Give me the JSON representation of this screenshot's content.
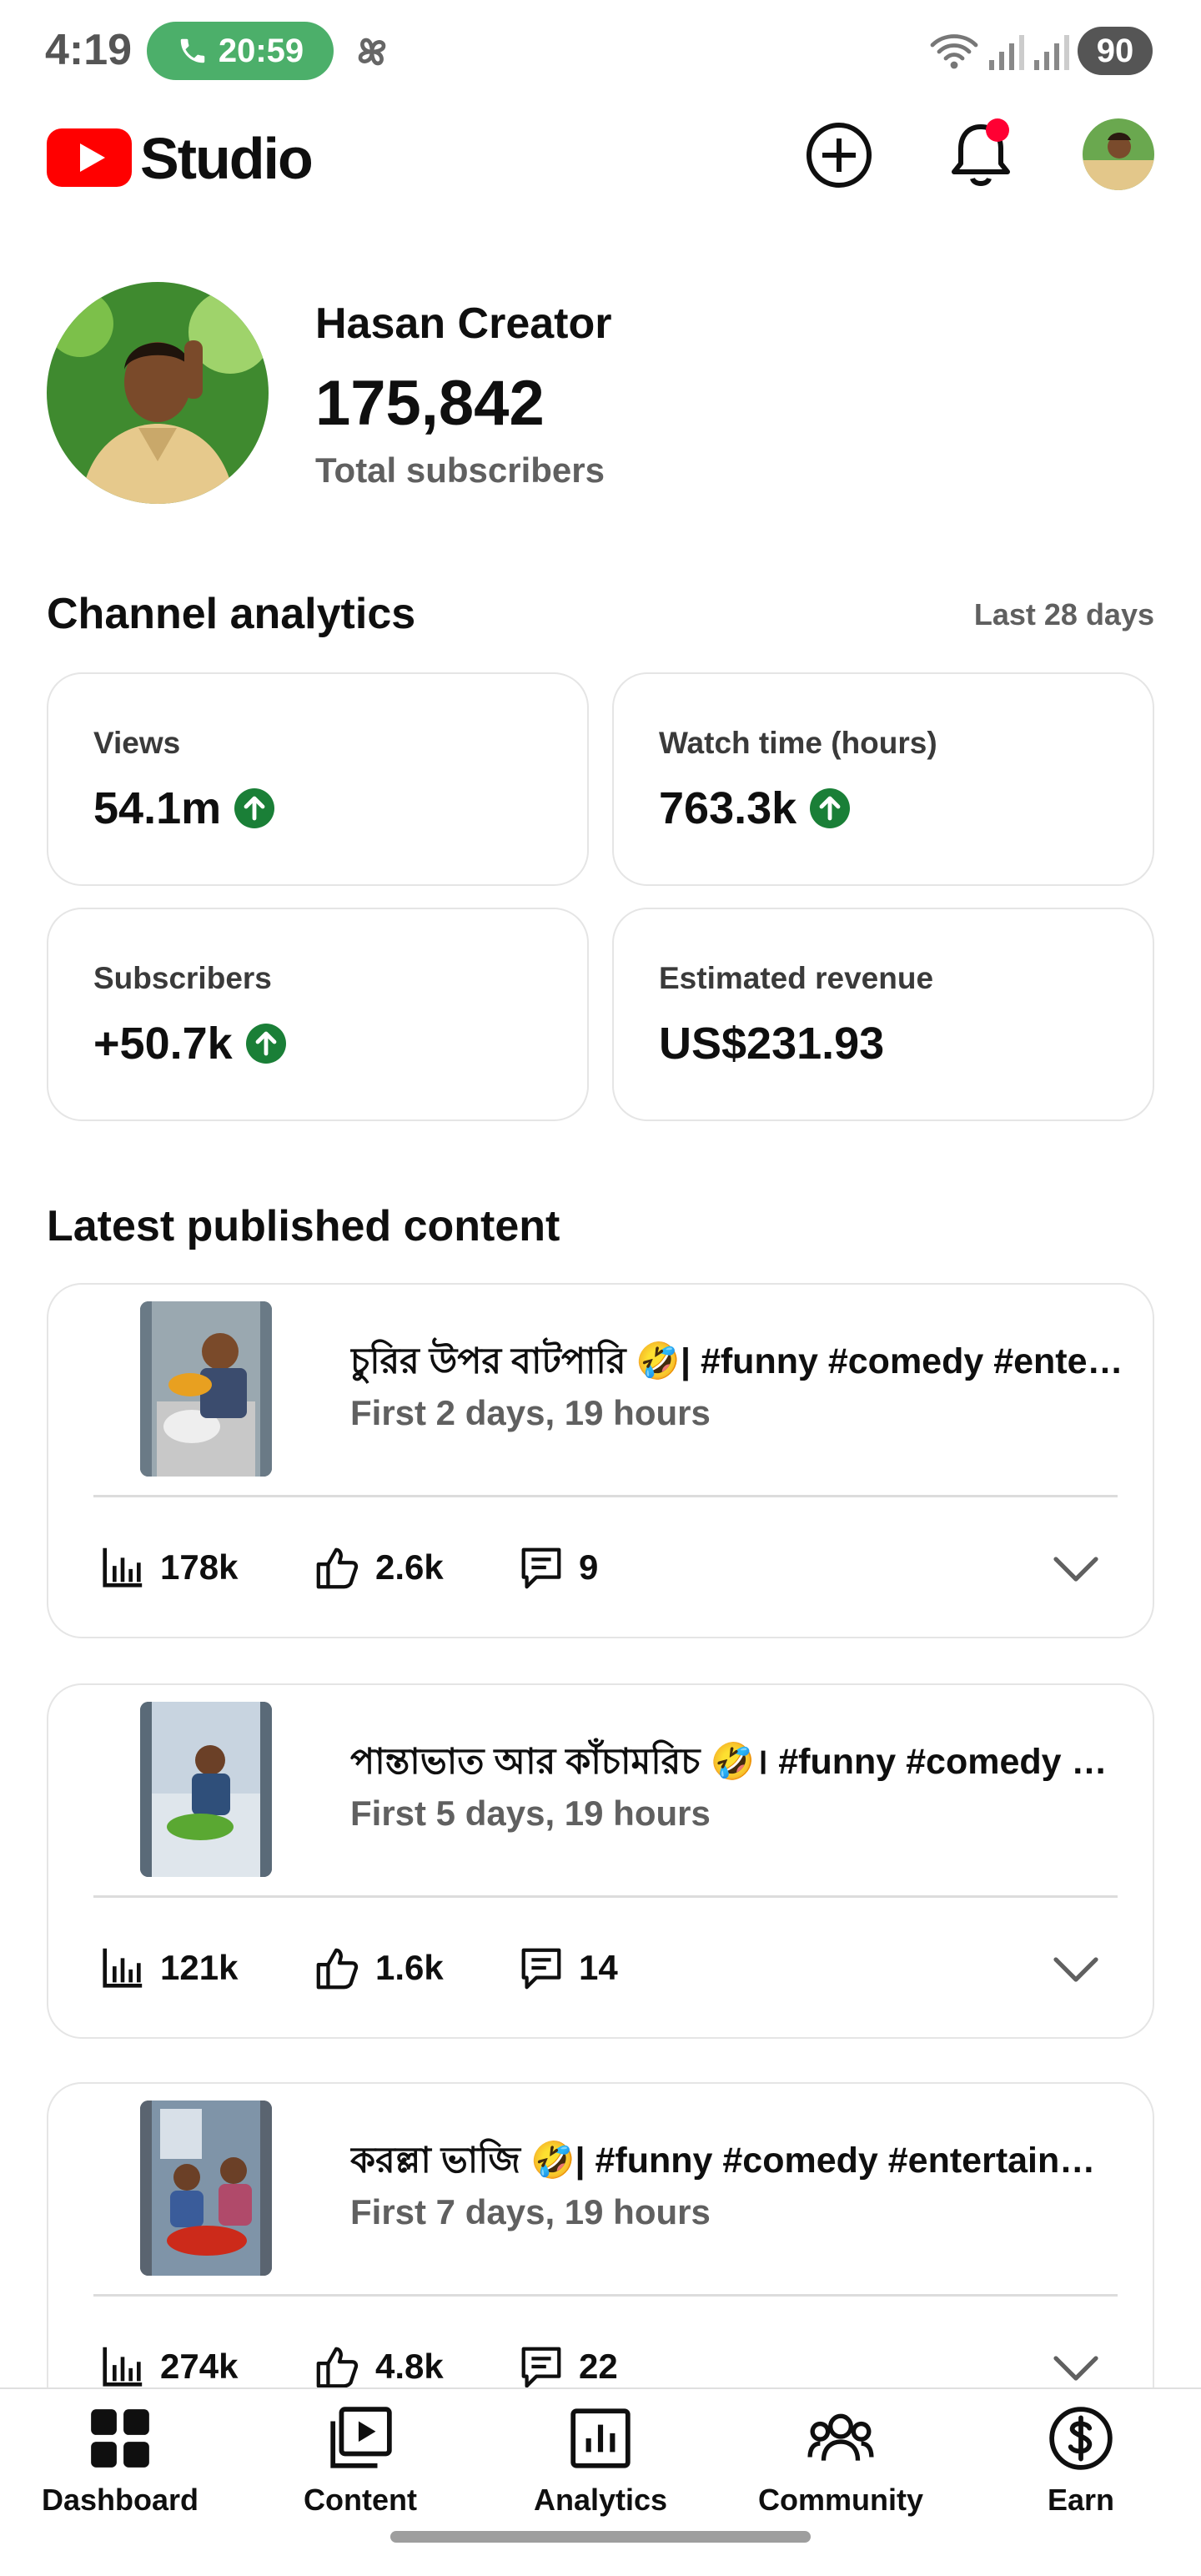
{
  "status_bar": {
    "time": "4:19",
    "call_duration": "20:59",
    "battery_level": "90",
    "icons": [
      "phone-icon",
      "pinwheel-icon",
      "wifi-icon",
      "signal-icon",
      "signal-icon"
    ]
  },
  "header": {
    "app_name": "Studio",
    "icons": [
      "youtube-logo",
      "create-icon",
      "notifications-icon",
      "account-avatar"
    ],
    "colors": {
      "brand": "#ff0000",
      "notification_dot": "#ff0033"
    }
  },
  "channel": {
    "name": "Hasan Creator",
    "subscriber_count": "175,842",
    "subscriber_label": "Total subscribers"
  },
  "analytics": {
    "title": "Channel analytics",
    "period": "Last 28 days",
    "colors": {
      "trend_up": "#1a7f37"
    },
    "cards": [
      {
        "label": "Views",
        "value": "54.1m",
        "trend": "up"
      },
      {
        "label": "Watch time (hours)",
        "value": "763.3k",
        "trend": "up"
      },
      {
        "label": "Subscribers",
        "value": "+50.7k",
        "trend": "up"
      },
      {
        "label": "Estimated revenue",
        "value": "US$231.93",
        "trend": "none"
      }
    ]
  },
  "latest": {
    "title": "Latest published content",
    "items": [
      {
        "title": "চুরির উপর বাটপারি 🤣| #funny #comedy #entertainment",
        "age": "First 2 days, 19 hours",
        "views": "178k",
        "likes": "2.6k",
        "comments": "9"
      },
      {
        "title": "পান্তাভাত আর কাঁচামরিচ 🤣। #funny #comedy #entertainment",
        "age": "First 5 days, 19 hours",
        "views": "121k",
        "likes": "1.6k",
        "comments": "14"
      },
      {
        "title": "করল্লা ভাজি 🤣| #funny #comedy #entertainment",
        "age": "First 7 days, 19 hours",
        "views": "274k",
        "likes": "4.8k",
        "comments": "22"
      }
    ]
  },
  "bottom_nav": {
    "items": [
      {
        "label": "Dashboard",
        "icon": "dashboard-icon",
        "active": true
      },
      {
        "label": "Content",
        "icon": "content-icon",
        "active": false
      },
      {
        "label": "Analytics",
        "icon": "analytics-icon",
        "active": false
      },
      {
        "label": "Community",
        "icon": "community-icon",
        "active": false
      },
      {
        "label": "Earn",
        "icon": "earn-icon",
        "active": false
      }
    ]
  }
}
